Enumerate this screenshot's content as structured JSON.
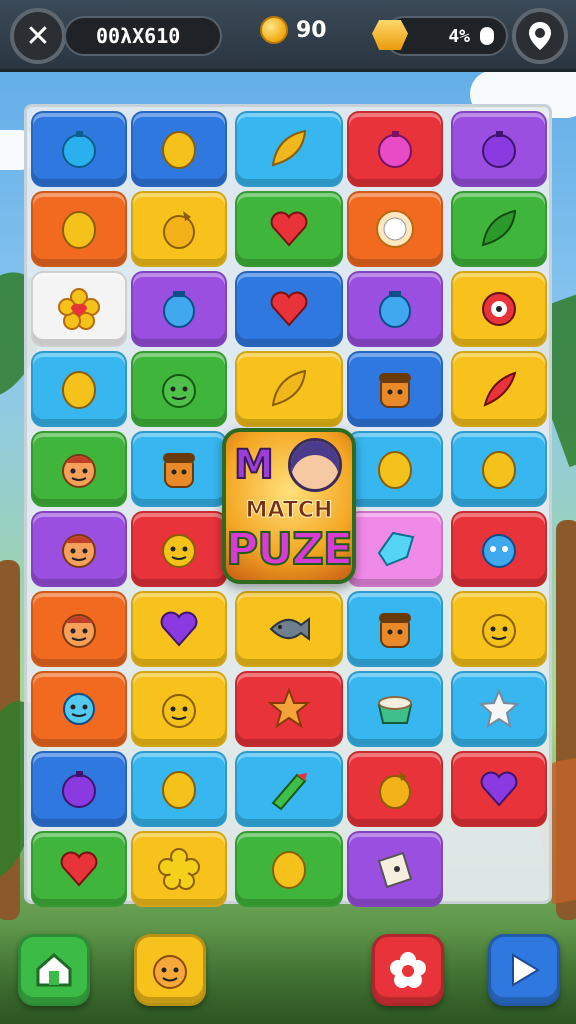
{
  "header": {
    "close_label": "✕",
    "score_text": "00λX610",
    "coins_value": "90",
    "gems_value": "4%"
  },
  "logo": {
    "line1": "MATCH",
    "line2": "PUZE"
  },
  "colors": {
    "blue": "#2f78e0",
    "cyan": "#37b6f0",
    "red": "#e8333a",
    "purple": "#9a4fe0",
    "orange": "#f16a1f",
    "yellow": "#f7c21c",
    "green": "#3fb53b",
    "white": "#f4f4f4",
    "pink": "#f08ae8",
    "lightcyan": "#55d4f6"
  },
  "board": {
    "rows": [
      [
        "blue:orb-blue",
        "blue:lemon",
        "cyan:leaf-yellow",
        "red:orb-pink",
        "purple:orb-purple"
      ],
      [
        "orange:lemon",
        "yellow:acorn",
        "green:heart",
        "orange:sun",
        "green:leaf-green"
      ],
      [
        "white:flower",
        "purple:jar-blue",
        "blue:heart",
        "purple:jar-blue",
        "yellow:eye"
      ],
      [
        "cyan:lemon",
        "green:monster-green",
        "yellow:leaf-yellow",
        "blue:acorn-face",
        "yellow:feather"
      ],
      [
        "green:face",
        "cyan:acorn-face",
        "",
        "cyan:lemon",
        "cyan:lemon"
      ],
      [
        "purple:face",
        "red:face-yellow",
        "",
        "pink:gem-cyan",
        "red:monster-blue"
      ],
      [
        "orange:face",
        "yellow:heart-purple",
        "yellow:fish",
        "cyan:acorn-face",
        "yellow:face-yellow"
      ],
      [
        "orange:face-blue",
        "yellow:face-yellow",
        "red:starfish",
        "cyan:cake",
        "cyan:star-white"
      ],
      [
        "blue:orb-purple",
        "cyan:lemon",
        "cyan:crayon",
        "red:acorn",
        "red:heart-purple"
      ],
      [
        "green:heart",
        "yellow:flower-yellow",
        "green:lemon",
        "purple:note",
        ""
      ]
    ]
  },
  "footer": {
    "home_icon": "home-icon",
    "hint_icon": "character-icon",
    "shop_icon": "flower-icon",
    "play_icon": "play-icon"
  }
}
